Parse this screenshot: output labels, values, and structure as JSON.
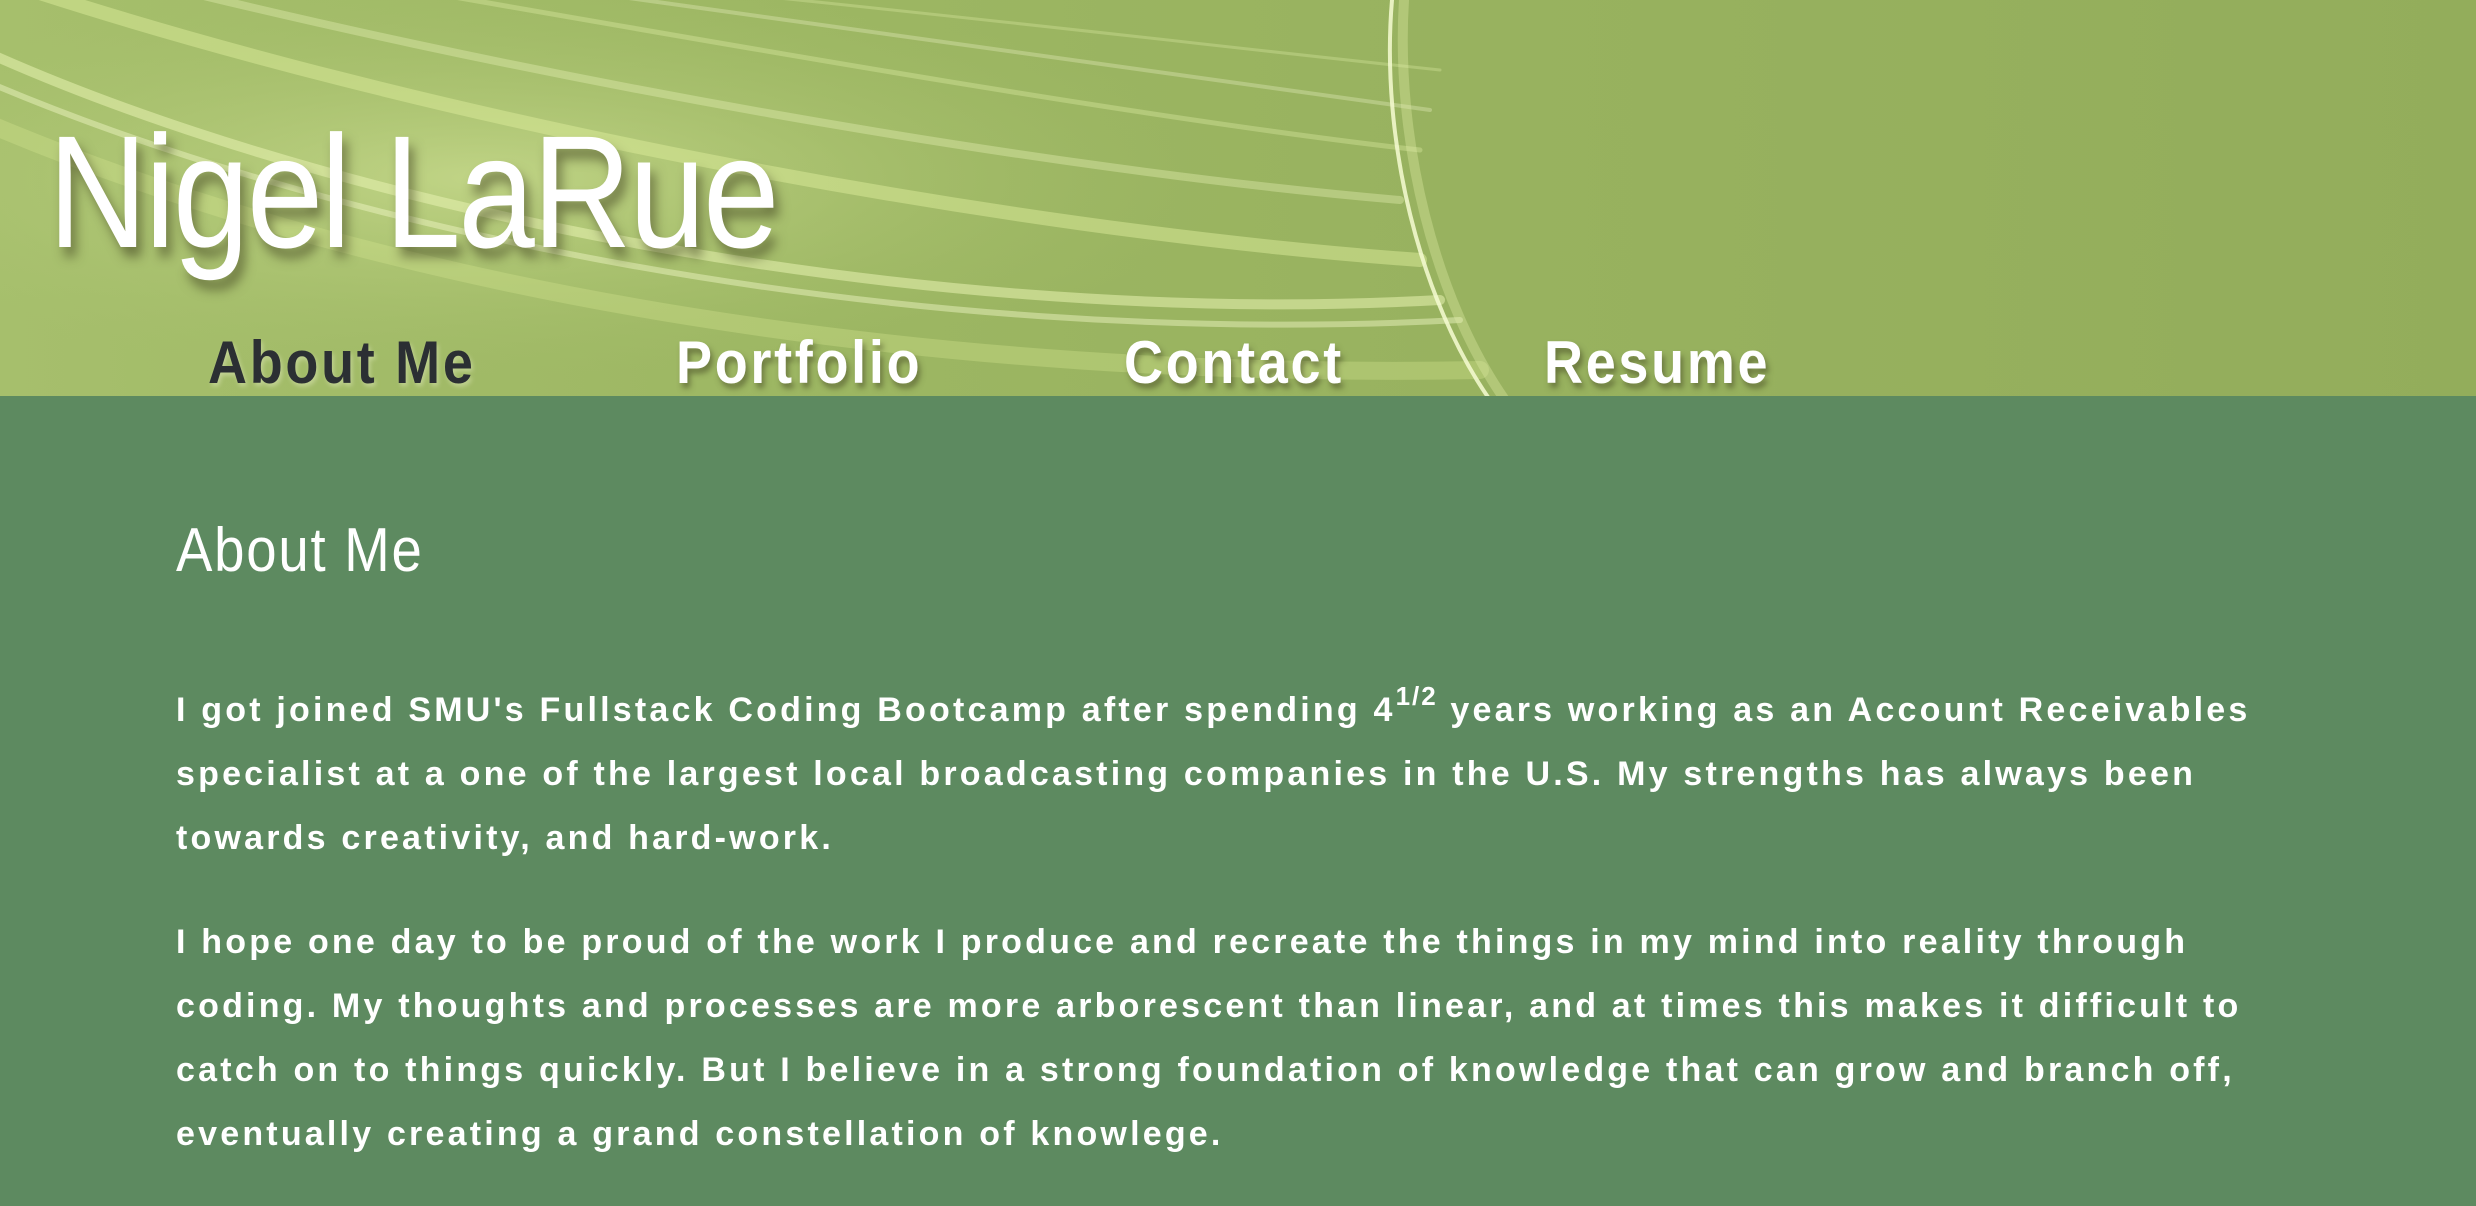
{
  "header": {
    "site_title": "Nigel LaRue"
  },
  "nav": {
    "items": [
      {
        "label": "About Me",
        "active": true
      },
      {
        "label": "Portfolio",
        "active": false
      },
      {
        "label": "Contact",
        "active": false
      },
      {
        "label": "Resume",
        "active": false
      }
    ]
  },
  "about": {
    "title": "About Me",
    "p1_before": "I got joined SMU's Fullstack Coding Bootcamp after spending 4",
    "p1_sup": "1/2",
    "p1_after": " years working as an Account Receivables specialist at a one of the largest local broadcasting companies in the U.S. My strengths has always been towards creativity, and hard-work.",
    "p2": "I hope one day to be proud of the work I produce and recreate the things in my mind into reality through coding. My thoughts and processes are more arborescent than linear, and at times this makes it difficult to catch on to things quickly. But I believe in a strong foundation of knowledge that can grow and branch off, eventually creating a grand constellation of knowlege."
  },
  "colors": {
    "header_green": "#9cb662",
    "body_green": "#5d8a60",
    "text_white": "#ffffff",
    "active_nav": "#2b2f33"
  }
}
